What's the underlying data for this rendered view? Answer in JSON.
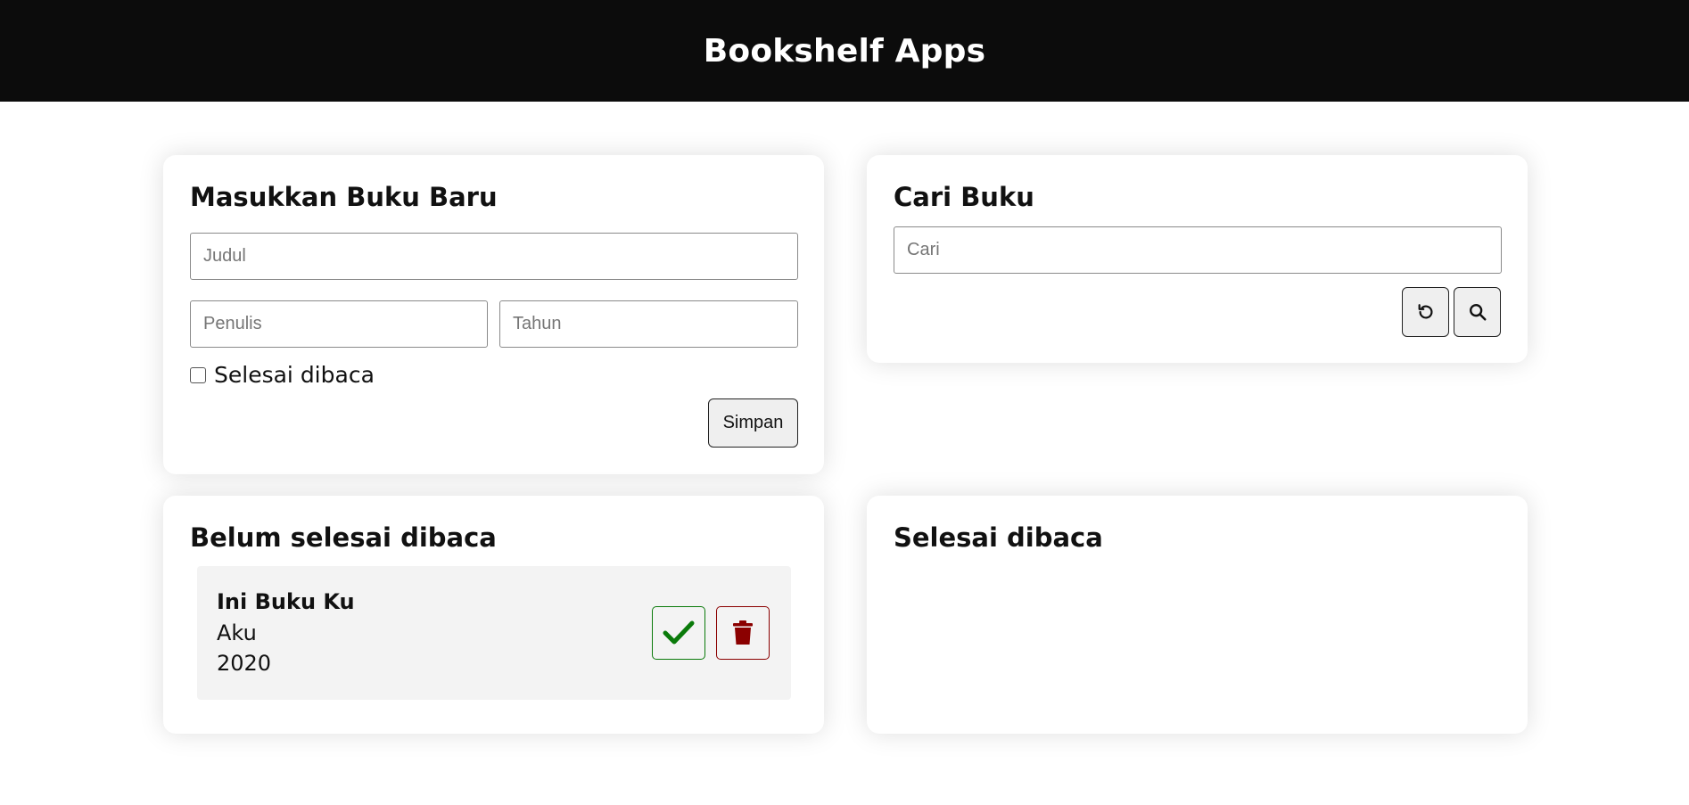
{
  "app": {
    "title": "Bookshelf Apps"
  },
  "add_form": {
    "heading": "Masukkan Buku Baru",
    "title_placeholder": "Judul",
    "author_placeholder": "Penulis",
    "year_placeholder": "Tahun",
    "finished_label": "Selesai dibaca",
    "finished_checked": false,
    "submit_label": "Simpan"
  },
  "search": {
    "heading": "Cari Buku",
    "placeholder": "Cari",
    "reset_icon": "reset-icon",
    "search_icon": "search-icon"
  },
  "unread_shelf": {
    "heading": "Belum selesai dibaca",
    "books": [
      {
        "title": "Ini Buku Ku",
        "author": "Aku",
        "year": "2020"
      }
    ]
  },
  "read_shelf": {
    "heading": "Selesai dibaca",
    "books": []
  },
  "colors": {
    "header_bg": "#0c0c0c",
    "done_green": "#0a7a0a",
    "delete_red": "#8b0000"
  }
}
